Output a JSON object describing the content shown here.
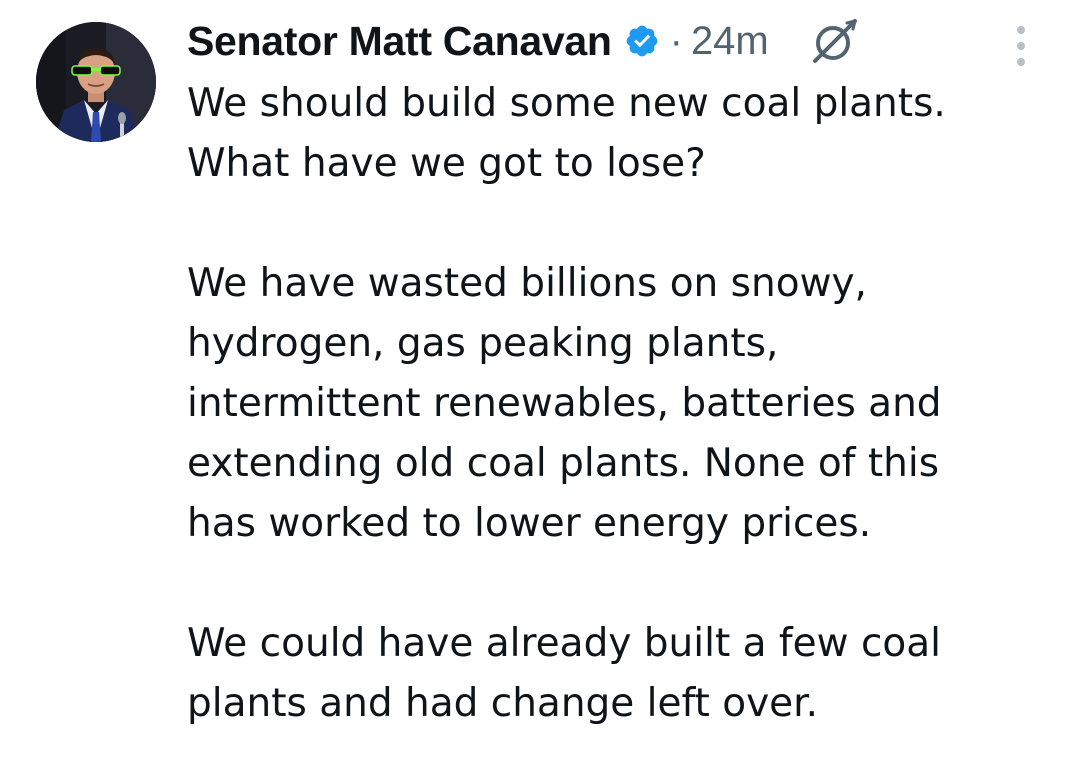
{
  "post": {
    "author": {
      "name": "Senator Matt Canavan",
      "verified": true,
      "verified_icon": "verified-badge-icon",
      "avatar": "author-avatar"
    },
    "separator": "·",
    "timestamp": "24m",
    "grok_icon": "grok-icon",
    "more_icon": "more-options-icon",
    "paragraphs": [
      {
        "line1": "We should build some new coal plants.",
        "line2": "What have we got to lose?"
      },
      {
        "line1": "We have wasted billions on snowy,",
        "line2": "hydrogen, gas peaking plants,",
        "line3": "intermittent renewables, batteries and",
        "line4": "extending old coal plants. None of this",
        "line5": "has worked to lower energy prices."
      },
      {
        "line1": "We could have already built a few coal",
        "line2": "plants and had change left over."
      }
    ]
  },
  "colors": {
    "text": "#0f1419",
    "muted": "#536471",
    "verified_blue": "#1d9bf0",
    "dots": "#b9c1c7"
  }
}
